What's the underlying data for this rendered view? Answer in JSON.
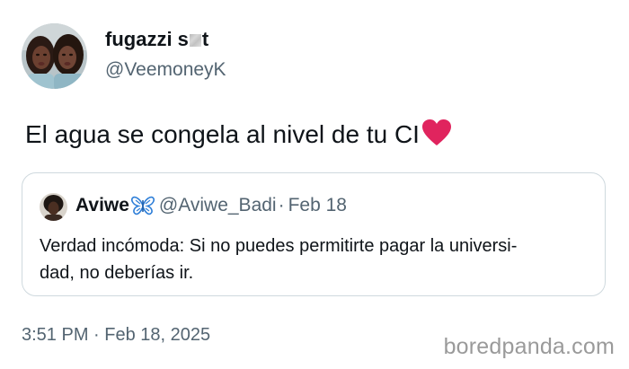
{
  "author": {
    "display_name_start": "fugazzi s",
    "display_name_end": "t",
    "handle": "@VeemoneyK",
    "avatar": "two-women-selfie-avatar"
  },
  "tweet": {
    "text": "El agua se congela al nivel de tu CI",
    "emoji": "heart-icon",
    "emoji_color": "#e0245e"
  },
  "quote": {
    "name": "Aviwe",
    "emoji": "butterfly-icon",
    "emoji_color": "#3a8ee6",
    "handle": "@Aviwe_Badi",
    "separator": "·",
    "date": "Feb 18",
    "line1": "Verdad incómoda: Si no puedes permitirte pagar la universi-",
    "line2": "dad, no deberías ir."
  },
  "timestamp": "3:51 PM · Feb 18, 2025",
  "watermark": "boredpanda.com",
  "colors": {
    "text": "#0f1419",
    "secondary": "#536471",
    "border": "#cfd9de",
    "watermark": "#9a9a9a"
  }
}
